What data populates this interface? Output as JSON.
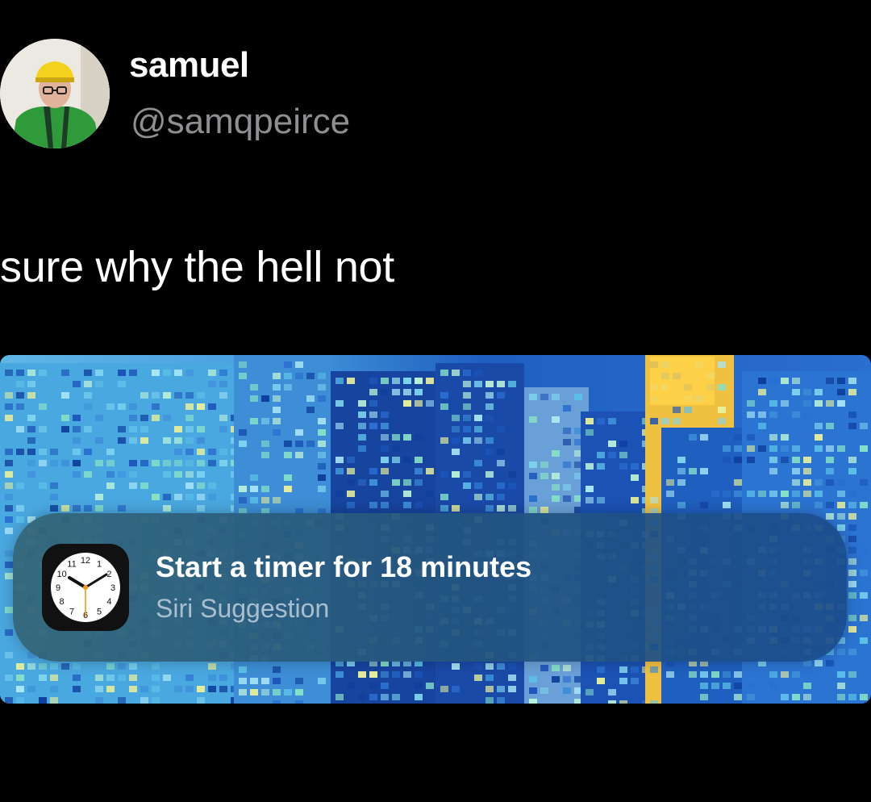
{
  "tweet": {
    "author": {
      "display_name": "samuel",
      "handle": "@samqpeirce"
    },
    "text": "sure why the hell not"
  },
  "siri_suggestion": {
    "title": "Start a timer for 18 minutes",
    "subtitle": "Siri Suggestion",
    "icon": "clock-icon",
    "clock_numerals": [
      "12",
      "1",
      "2",
      "3",
      "4",
      "5",
      "6",
      "7",
      "8",
      "9",
      "10",
      "11"
    ]
  },
  "colors": {
    "background": "#000000",
    "handle_gray": "#8e8e93",
    "card_tint": "#2a5a82",
    "subtitle": "#a9bfd0"
  }
}
